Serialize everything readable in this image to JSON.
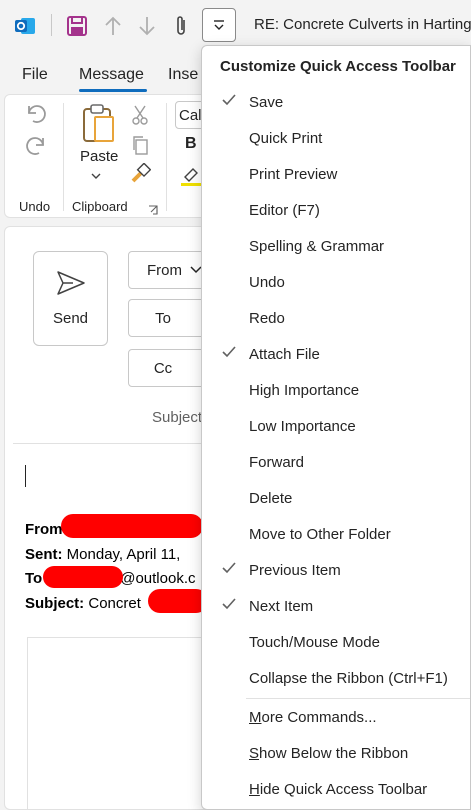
{
  "window": {
    "title": "RE: Concrete Culverts in Hartington"
  },
  "tabs": {
    "file": "File",
    "message": "Message",
    "insert": "Inse"
  },
  "ribbon": {
    "undo_label": "Undo",
    "clipboard_label": "Clipboard",
    "paste_label": "Paste",
    "font_name": "Cali",
    "bold_label": "B"
  },
  "compose": {
    "send_label": "Send",
    "from_label": "From",
    "to_label": "To",
    "cc_label": "Cc",
    "subject_label": "Subject",
    "quoted": {
      "from_label": "From",
      "sent_label": "Sent:",
      "sent_value": " Monday, April 11,",
      "to_label": "To",
      "to_value": "@outlook.c",
      "subject_label": "Subject:",
      "subject_value": " Concret"
    }
  },
  "menu": {
    "title": "Customize Quick Access Toolbar",
    "items": [
      {
        "label": "Save",
        "checked": true
      },
      {
        "label": "Quick Print",
        "checked": false
      },
      {
        "label": "Print Preview",
        "checked": false
      },
      {
        "label": "Editor (F7)",
        "checked": false
      },
      {
        "label": "Spelling & Grammar",
        "checked": false
      },
      {
        "label": "Undo",
        "checked": false
      },
      {
        "label": "Redo",
        "checked": false
      },
      {
        "label": "Attach File",
        "checked": true
      },
      {
        "label": "High Importance",
        "checked": false
      },
      {
        "label": "Low Importance",
        "checked": false
      },
      {
        "label": "Forward",
        "checked": false
      },
      {
        "label": "Delete",
        "checked": false
      },
      {
        "label": "Move to Other Folder",
        "checked": false
      },
      {
        "label": "Previous Item",
        "checked": true
      },
      {
        "label": "Next Item",
        "checked": true
      },
      {
        "label": "Touch/Mouse Mode",
        "checked": false
      },
      {
        "label": "Collapse the Ribbon (Ctrl+F1)",
        "checked": false
      }
    ],
    "commands": [
      {
        "accel": "M",
        "rest": "ore Commands..."
      },
      {
        "accel": "S",
        "rest": "how Below the Ribbon"
      },
      {
        "accel": "H",
        "rest": "ide Quick Access Toolbar"
      }
    ]
  },
  "colors": {
    "accent": "#0f6cbd",
    "save_icon": "#a4338c",
    "redaction": "#ff0000"
  }
}
